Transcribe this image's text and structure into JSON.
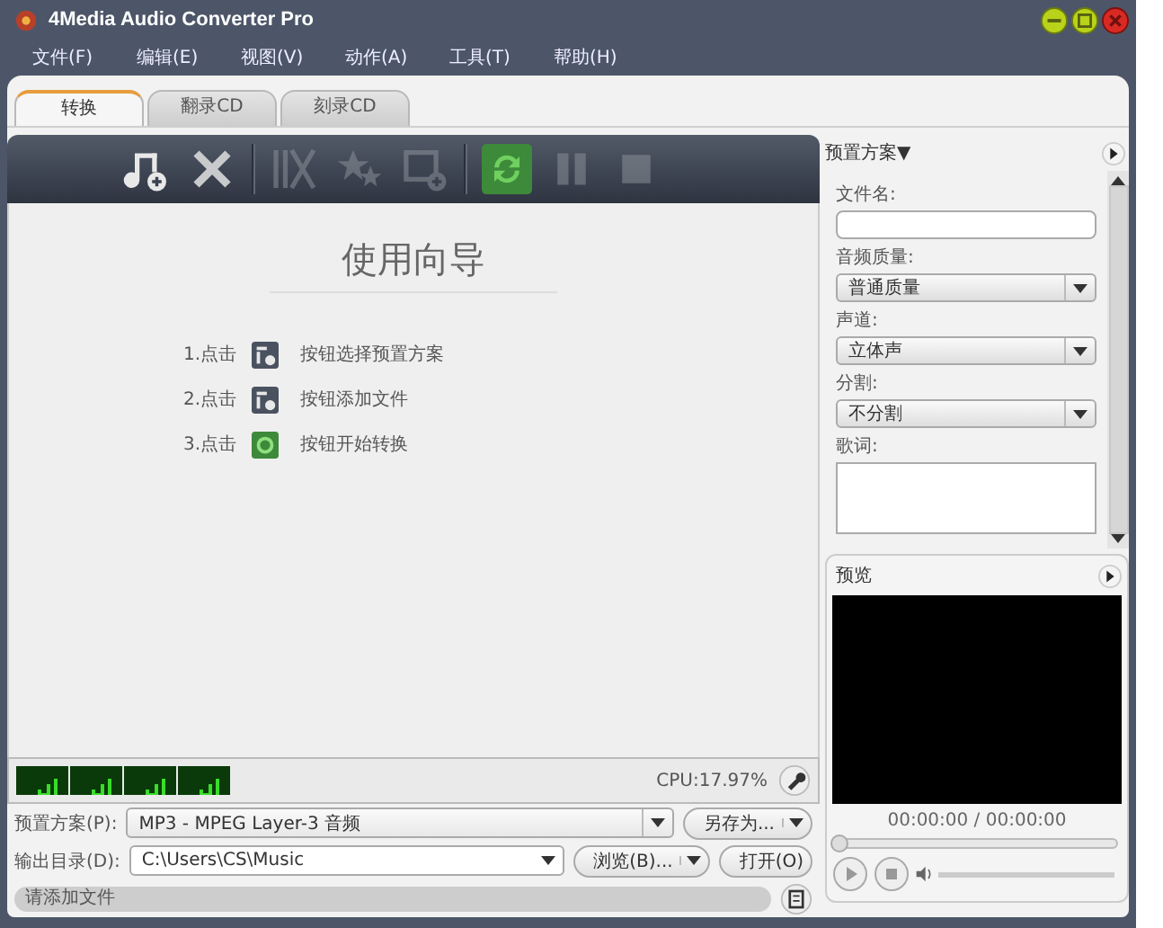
{
  "window": {
    "title": "4Media Audio Converter Pro"
  },
  "menu": [
    "文件(F)",
    "编辑(E)",
    "视图(V)",
    "动作(A)",
    "工具(T)",
    "帮助(H)"
  ],
  "tabs": [
    {
      "label": "转换",
      "selected": true
    },
    {
      "label": "翻录CD",
      "selected": false
    },
    {
      "label": "刻录CD",
      "selected": false
    }
  ],
  "toolbar": [
    {
      "kind": "add",
      "disabled": false
    },
    {
      "kind": "delete",
      "disabled": false
    },
    {
      "kind": "cut",
      "disabled": true
    },
    {
      "kind": "effects",
      "disabled": true
    },
    {
      "kind": "merge",
      "disabled": true
    },
    {
      "kind": "convert",
      "disabled": false
    },
    {
      "kind": "pause",
      "disabled": true
    },
    {
      "kind": "stop",
      "disabled": true
    }
  ],
  "wizard": {
    "title": "使用向导",
    "steps": [
      {
        "prefix": "1.点击",
        "text": "按钮选择预置方案"
      },
      {
        "prefix": "2.点击",
        "text": "按钮添加文件"
      },
      {
        "prefix": "3.点击",
        "text": "按钮开始转换"
      }
    ]
  },
  "cpu": "CPU:17.97%",
  "preset": {
    "label": "预置方案(P):",
    "value": "MP3 - MPEG Layer-3 音频",
    "button": "另存为..."
  },
  "output": {
    "label": "输出目录(D):",
    "value": "C:\\Users\\CS\\Music",
    "browse": "浏览(B)...",
    "open": "打开(O)"
  },
  "status": "请添加文件",
  "side": {
    "title": "预置方案",
    "caret": "▼",
    "fields": [
      {
        "kind": "text",
        "label": "文件名:"
      },
      {
        "kind": "select",
        "label": "音频质量:",
        "value": "普通质量"
      },
      {
        "kind": "select",
        "label": "声道:",
        "value": "立体声"
      },
      {
        "kind": "select",
        "label": "分割:",
        "value": "不分割"
      },
      {
        "kind": "textarea",
        "label": "歌词:"
      }
    ]
  },
  "preview": {
    "title": "预览",
    "time": "00:00:00 / 00:00:00",
    "level": 0
  }
}
